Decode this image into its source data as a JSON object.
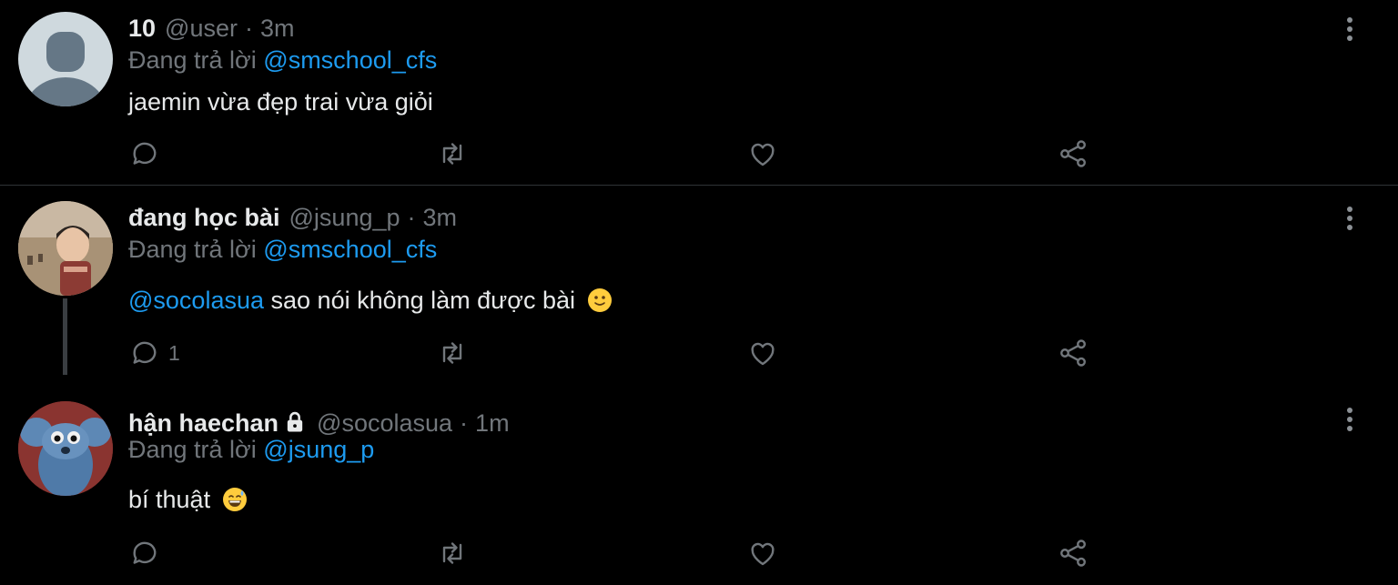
{
  "tweets": [
    {
      "name": "10",
      "handle": "@user",
      "time": "3m",
      "replying_prefix": "Đang trả lời",
      "replying_to": "@smschool_cfs",
      "text": "jaemin vừa đẹp trai vừa giỏi",
      "reply_count": "",
      "avatar": "default-avatar"
    },
    {
      "name": "đang học bài",
      "handle": "@jsung_p",
      "time": "3m",
      "replying_prefix": "Đang trả lời",
      "replying_to": "@smschool_cfs",
      "text_mention": "@socolasua",
      "text": "sao nói không làm được bài",
      "emoji": "slightly-smiling-face",
      "reply_count": "1",
      "avatar": "child-photo-avatar"
    },
    {
      "name": "hận haechan",
      "handle": "@socolasua",
      "time": "1m",
      "protected_icon": "lock-icon",
      "replying_prefix": "Đang trả lời",
      "replying_to": "@jsung_p",
      "text": "bí thuật",
      "emoji": "grinning-sweat-face",
      "reply_count": "",
      "avatar": "blue-mouse-avatar"
    }
  ],
  "colors": {
    "background": "#000000",
    "text": "#e7e9ea",
    "muted": "#71767b",
    "link": "#1d9bf0",
    "divider": "#2f3336"
  }
}
